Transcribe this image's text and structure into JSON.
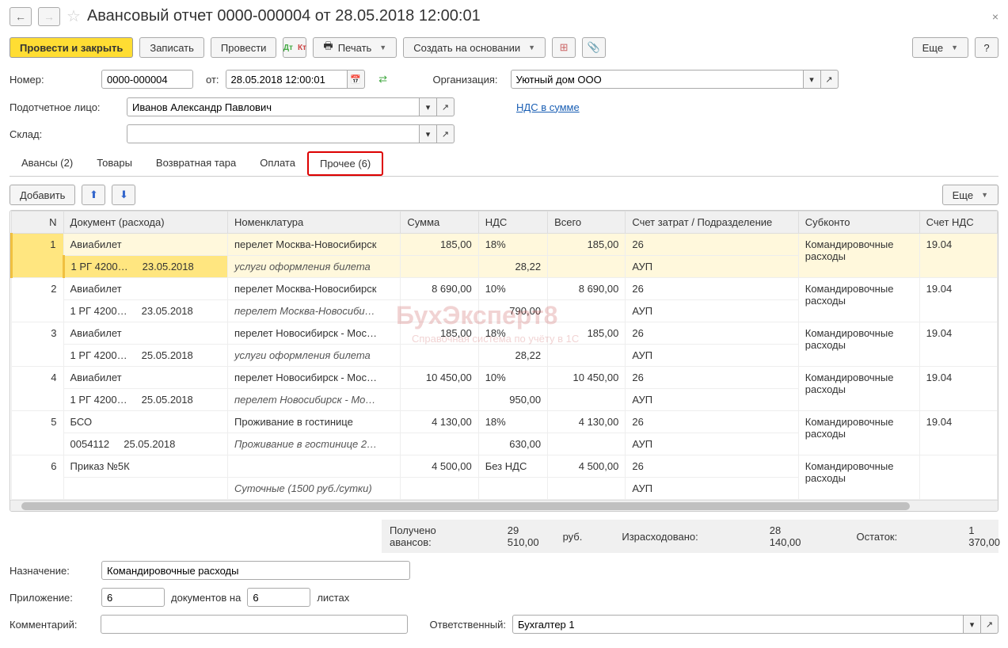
{
  "nav": {
    "back": "←",
    "fwd": "→"
  },
  "title": "Авансовый отчет 0000-000004 от 28.05.2018 12:00:01",
  "close": "×",
  "toolbar": {
    "post_close": "Провести и закрыть",
    "save": "Записать",
    "post": "Провести",
    "print": "Печать",
    "create_based": "Создать на основании",
    "more": "Еще",
    "help": "?"
  },
  "form": {
    "number_label": "Номер:",
    "number": "0000-000004",
    "from_label": "от:",
    "date": "28.05.2018 12:00:01",
    "org_label": "Организация:",
    "org": "Уютный дом ООО",
    "person_label": "Подотчетное лицо:",
    "person": "Иванов Александр Павлович",
    "nds_link": "НДС в сумме",
    "warehouse_label": "Склад:",
    "warehouse": ""
  },
  "tabs": [
    {
      "label": "Авансы (2)"
    },
    {
      "label": "Товары"
    },
    {
      "label": "Возвратная тара"
    },
    {
      "label": "Оплата"
    },
    {
      "label": "Прочее (6)",
      "active": true
    }
  ],
  "table_toolbar": {
    "add": "Добавить",
    "more": "Еще"
  },
  "columns": [
    "N",
    "Документ (расхода)",
    "Номенклатура",
    "Сумма",
    "НДС",
    "Всего",
    "Счет затрат / Подразделение",
    "Субконто",
    "Счет НДС"
  ],
  "rows": [
    {
      "n": "1",
      "selected": true,
      "doc1": "Авиабилет",
      "doc2": "1 РГ 4200…",
      "doc_date": "23.05.2018",
      "nom1": "перелет Москва-Новосибирск",
      "nom2": "услуги оформления билета",
      "sum": "185,00",
      "nds_rate": "18%",
      "nds_val": "28,22",
      "total": "185,00",
      "acc1": "26",
      "acc2": "АУП",
      "sub": "Командировочные расходы",
      "nds_acc": "19.04"
    },
    {
      "n": "2",
      "doc1": "Авиабилет",
      "doc2": "1 РГ 4200…",
      "doc_date": "23.05.2018",
      "nom1": "перелет Москва-Новосибирск",
      "nom2": "перелет Москва-Новосиби…",
      "sum": "8 690,00",
      "nds_rate": "10%",
      "nds_val": "790,00",
      "total": "8 690,00",
      "acc1": "26",
      "acc2": "АУП",
      "sub": "Командировочные расходы",
      "nds_acc": "19.04"
    },
    {
      "n": "3",
      "doc1": "Авиабилет",
      "doc2": "1 РГ 4200…",
      "doc_date": "25.05.2018",
      "nom1": "перелет Новосибирск - Мос…",
      "nom2": "услуги оформления билета",
      "sum": "185,00",
      "nds_rate": "18%",
      "nds_val": "28,22",
      "total": "185,00",
      "acc1": "26",
      "acc2": "АУП",
      "sub": "Командировочные расходы",
      "nds_acc": "19.04"
    },
    {
      "n": "4",
      "doc1": "Авиабилет",
      "doc2": "1 РГ 4200…",
      "doc_date": "25.05.2018",
      "nom1": "перелет Новосибирск - Мос…",
      "nom2": "перелет Новосибирск - Мо…",
      "sum": "10 450,00",
      "nds_rate": "10%",
      "nds_val": "950,00",
      "total": "10 450,00",
      "acc1": "26",
      "acc2": "АУП",
      "sub": "Командировочные расходы",
      "nds_acc": "19.04"
    },
    {
      "n": "5",
      "doc1": "БСО",
      "doc2": "0054112",
      "doc_date": "25.05.2018",
      "nom1": "Проживание в гостинице",
      "nom2": "Проживание в гостинице 2…",
      "sum": "4 130,00",
      "nds_rate": "18%",
      "nds_val": "630,00",
      "total": "4 130,00",
      "acc1": "26",
      "acc2": "АУП",
      "sub": "Командировочные расходы",
      "nds_acc": "19.04"
    },
    {
      "n": "6",
      "doc1": "Приказ №5К",
      "doc2": "",
      "doc_date": "",
      "nom1": "",
      "nom2": "Суточные (1500 руб./сутки)",
      "sum": "4 500,00",
      "nds_rate": "Без НДС",
      "nds_val": "",
      "total": "4 500,00",
      "acc1": "26",
      "acc2": "АУП",
      "sub": "Командировочные расходы",
      "nds_acc": ""
    }
  ],
  "totals": {
    "avans_label": "Получено авансов:",
    "avans": "29 510,00",
    "currency": "руб.",
    "spent_label": "Израсходовано:",
    "spent": "28 140,00",
    "rest_label": "Остаток:",
    "rest": "1 370,00"
  },
  "footer": {
    "purpose_label": "Назначение:",
    "purpose": "Командировочные расходы",
    "attach_label": "Приложение:",
    "docs": "6",
    "docs_on": "документов на",
    "pages": "6",
    "pages_label": "листах",
    "comment_label": "Комментарий:",
    "comment": "",
    "resp_label": "Ответственный:",
    "resp": "Бухгалтер 1"
  },
  "watermark": "БухЭксперт8",
  "watermark_sub": "Справочная система по учёту в 1С"
}
